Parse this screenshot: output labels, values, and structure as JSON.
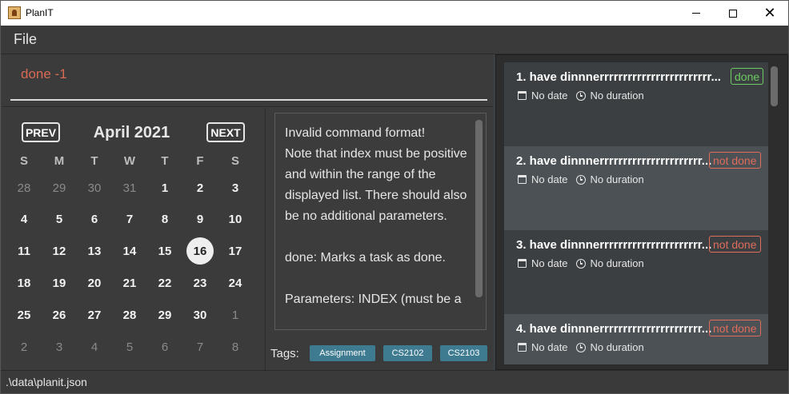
{
  "window": {
    "title": "PlanIT"
  },
  "menu": {
    "file": "File"
  },
  "command": {
    "value": "done -1"
  },
  "calendar": {
    "prev": "PREV",
    "next": "NEXT",
    "month": "April 2021",
    "weekdays": [
      "S",
      "M",
      "T",
      "W",
      "T",
      "F",
      "S"
    ],
    "weeks": [
      [
        "28",
        "29",
        "30",
        "31",
        "1",
        "2",
        "3"
      ],
      [
        "4",
        "5",
        "6",
        "7",
        "8",
        "9",
        "10"
      ],
      [
        "11",
        "12",
        "13",
        "14",
        "15",
        "16",
        "17"
      ],
      [
        "18",
        "19",
        "20",
        "21",
        "22",
        "23",
        "24"
      ],
      [
        "25",
        "26",
        "27",
        "28",
        "29",
        "30",
        "1"
      ],
      [
        "2",
        "3",
        "4",
        "5",
        "6",
        "7",
        "8"
      ]
    ],
    "today": "16"
  },
  "result": {
    "text": "Invalid command format!\nNote that index must be positive and within the range of the displayed list. There should also be no additional parameters.\n\ndone: Marks a task as done.\n\nParameters: INDEX (must be a"
  },
  "tags": {
    "label": "Tags:",
    "items": [
      "Assignment",
      "CS2102",
      "CS2103"
    ]
  },
  "tasks": [
    {
      "title": "1.  have dinnnerrrrrrrrrrrrrrrrrrrrrrrr...",
      "status": "done",
      "date": "No date",
      "duration": "No duration"
    },
    {
      "title": "2.  have dinnnerrrrrrrrrrrrrrrrrrrrrr...",
      "status": "not done",
      "date": "No date",
      "duration": "No duration"
    },
    {
      "title": "3.  have dinnnerrrrrrrrrrrrrrrrrrrrrr...",
      "status": "not done",
      "date": "No date",
      "duration": "No duration"
    },
    {
      "title": "4.  have dinnnerrrrrrrrrrrrrrrrrrrrrr...",
      "status": "not done",
      "date": "No date",
      "duration": "No duration"
    }
  ],
  "statusbar": {
    "path": ".\\data\\planit.json"
  },
  "colors": {
    "done": "#6ecb63",
    "not_done": "#e06c5c",
    "tag": "#3e7b91",
    "command_text": "#d86a55"
  }
}
